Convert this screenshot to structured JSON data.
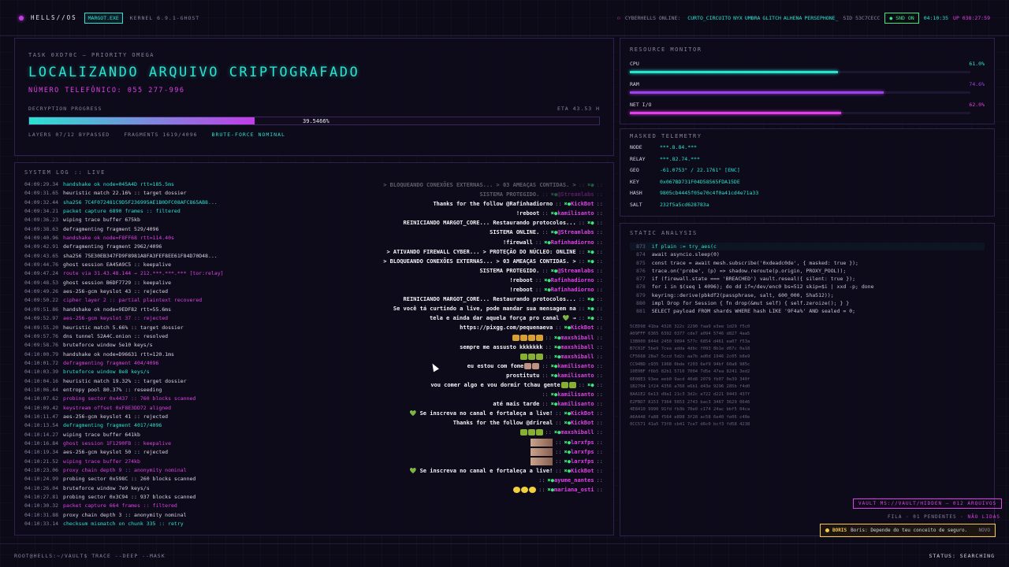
{
  "topbar": {
    "logo": "HELLS//OS",
    "process": "MARGOT.EXE",
    "kernel": "KERNEL 6.9.1-GHOST",
    "online_label": "CYBERHELLS ONLINE:",
    "online_users": [
      "CURTO_CIRCUITO",
      "NYX",
      "UMBRA",
      "GLITCH",
      "ALHENA",
      "PERSEPHONE_"
    ],
    "sid": "SID 53C7CECC",
    "snd": "SND ON",
    "clock": "04:10:35",
    "uptime": "UP 038:27:59"
  },
  "task": {
    "label": "TASK 0XD70C — PRIORITY OMEGA",
    "title": "LOCALIZANDO ARQUIVO CRIPTOGRAFADO",
    "phone": "NÚMERO TELEFÔNICO: 055 277-996",
    "progress_label": "DECRYPTION PROGRESS",
    "eta": "ETA 43.53 H",
    "progress": 0.395466,
    "progress_text": "39.5466%",
    "layers": "LAYERS 07/12 BYPASSED",
    "fragments": "FRAGMENTS 1619/4096",
    "mode": "BRUTE-FORCE NOMINAL"
  },
  "syslog": {
    "title": "SYSTEM LOG :: LIVE",
    "lines": [
      {
        "t": "04:09:29.34",
        "x": "handshake ok node=045A4D rtt=185.5ms",
        "c": "c"
      },
      {
        "t": "04:09:31.65",
        "x": "heuristic match 22.16% :: target dossier",
        "c": "w"
      },
      {
        "t": "04:09:32.44",
        "x": "sha256 7C4F072481C9D5F236995AE1B0DFC08AFC865AB8...",
        "c": "c"
      },
      {
        "t": "04:09:34.21",
        "x": "packet capture 6890 frames :: filtered",
        "c": "c"
      },
      {
        "t": "04:09:36.23",
        "x": "wiping trace buffer 675kb",
        "c": "w"
      },
      {
        "t": "04:09:38.63",
        "x": "defragmenting fragment 529/4096",
        "c": "w"
      },
      {
        "t": "04:09:40.96",
        "x": "handshake ok node=F8FF68 rtt=114.40s",
        "c": "m"
      },
      {
        "t": "04:09:42.91",
        "x": "defragmenting fragment 2962/4096",
        "c": "w"
      },
      {
        "t": "04:09:43.65",
        "x": "sha256 75E30EB347FD9F8981A8FA3FEF8EE61F84D70D48...",
        "c": "w"
      },
      {
        "t": "04:09:44.76",
        "x": "ghost session EA45A9C5 :: keepalive",
        "c": "w"
      },
      {
        "t": "04:09:47.24",
        "x": "route via 31.43.48.144 → 212.***.***.*** [tor:relay]",
        "c": "m"
      },
      {
        "t": "04:09:48.53",
        "x": "ghost session B6DF7729 :: keepalive",
        "c": "w"
      },
      {
        "t": "04:09:49.26",
        "x": "aes-256-gcm keyslot 43 :: rejected",
        "c": "w"
      },
      {
        "t": "04:09:50.22",
        "x": "cipher layer 2 :: partial plaintext recovered",
        "c": "m"
      },
      {
        "t": "04:09:51.86",
        "x": "handshake ok node=9EDF82 rtt=55.6ms",
        "c": "w"
      },
      {
        "t": "04:09:52.97",
        "x": "aes-256-gcm keyslot 37 :: rejected",
        "c": "m"
      },
      {
        "t": "04:09:55.20",
        "x": "heuristic match 5.66% :: target dossier",
        "c": "w"
      },
      {
        "t": "04:09:57.76",
        "x": "dns tunnel 52A4C.onion :: resolved",
        "c": "w"
      },
      {
        "t": "04:09:58.76",
        "x": "bruteforce window 5e10 keys/s",
        "c": "w"
      },
      {
        "t": "04:10:00.79",
        "x": "handshake ok node=D96631 rtt=120.1ms",
        "c": "w"
      },
      {
        "t": "04:10:01.72",
        "x": "defragmenting fragment 404/4096",
        "c": "m"
      },
      {
        "t": "04:10:03.39",
        "x": "bruteforce window 8e8 keys/s",
        "c": "c"
      },
      {
        "t": "04:10:04.16",
        "x": "heuristic match 19.32% :: target dossier",
        "c": "w"
      },
      {
        "t": "04:10:06.44",
        "x": "entropy pool 80.37% :: reseeding",
        "c": "w"
      },
      {
        "t": "04:10:07.62",
        "x": "probing sector 0x4437 :: 760 blocks scanned",
        "c": "m"
      },
      {
        "t": "04:10:09.42",
        "x": "keystream offset 0xF8E3DD72 aligned",
        "c": "m"
      },
      {
        "t": "04:10:11.47",
        "x": "aes-256-gcm keyslot 41 :: rejected",
        "c": "w"
      },
      {
        "t": "04:10:13.54",
        "x": "defragmenting fragment 4017/4096",
        "c": "c"
      },
      {
        "t": "04:10:14.27",
        "x": "wiping trace buffer 641kb",
        "c": "w"
      },
      {
        "t": "04:10:16.84",
        "x": "ghost session 1F1290FB :: keepalive",
        "c": "m"
      },
      {
        "t": "04:10:19.34",
        "x": "aes-256-gcm keyslot 50 :: rejected",
        "c": "w"
      },
      {
        "t": "04:10:21.52",
        "x": "wiping trace buffer 274kb",
        "c": "m"
      },
      {
        "t": "04:10:23.06",
        "x": "proxy chain depth 9 :: anonymity nominal",
        "c": "m"
      },
      {
        "t": "04:10:24.99",
        "x": "probing sector 0x598C :: 260 blocks scanned",
        "c": "w"
      },
      {
        "t": "04:10:26.04",
        "x": "bruteforce window 7e9 keys/s",
        "c": "w"
      },
      {
        "t": "04:10:27.81",
        "x": "probing sector 0x3C94 :: 937 blocks scanned",
        "c": "w"
      },
      {
        "t": "04:10:30.32",
        "x": "packet capture 664 frames :: filtered",
        "c": "m"
      },
      {
        "t": "04:10:31.88",
        "x": "proxy chain depth 3 :: anonymity nominal",
        "c": "w"
      },
      {
        "t": "04:10:33.14",
        "x": "checksum mismatch on chunk 335 :: retry",
        "c": "c"
      }
    ],
    "chat": [
      {
        "msg": "> BLOQUEANDO CONEXÕES EXTERNAS... > 03 AMEAÇAS CONTIDAS. >",
        "user": "",
        "fade": true
      },
      {
        "msg": "SISTEMA PROTEGIDO.",
        "user": "@Streamlabs",
        "fade": true
      },
      {
        "msg": "Thanks for the follow @Rafinhadiorno",
        "user": "KickBot"
      },
      {
        "msg": "!reboot",
        "user": "kamilisanto"
      },
      {
        "msg": "REINICIANDO MARGOT_CORE... Restaurando protocolos...",
        "user": ""
      },
      {
        "msg": "SISTEMA ONLINE.",
        "user": "@Streamlabs"
      },
      {
        "msg": "!firewall",
        "user": "Rafinhadiorno"
      },
      {
        "msg": "> ATIVANDO FIREWALL CYBER... > PROTEÇÃO DO NÚCLEO: ONLINE",
        "user": ""
      },
      {
        "msg": "> BLOQUEANDO CONEXÕES EXTERNAS... > 03 AMEAÇAS CONTIDAS. >",
        "user": ""
      },
      {
        "msg": "SISTEMA PROTEGIDO.",
        "user": "@Streamlabs"
      },
      {
        "msg": "!reboot",
        "user": "Rafinhadiorno"
      },
      {
        "msg": "!reboot",
        "user": "Rafinhadiorno"
      },
      {
        "msg": "REINICIANDO MARGOT_CORE... Restaurando protocolos...",
        "user": ""
      },
      {
        "msg": "Se você tá curtindo a live, pode mandar sua mensagem na",
        "user": ""
      },
      {
        "msg": "tela e ainda dar aquela força pro canal 💚 →",
        "user": ""
      },
      {
        "msg": "https://pixgg.com/pequenaeva",
        "user": "KickBot"
      },
      {
        "msg": "",
        "user": "maxshiball",
        "emotes": "yyyy"
      },
      {
        "msg": "sempre me assusto kkkkkkk",
        "user": "maxshiball"
      },
      {
        "msg": "",
        "user": "maxshiball",
        "emotes": "ggg"
      },
      {
        "msg": "eu estou com fome",
        "user": "kamilisanto",
        "emotes": "ss"
      },
      {
        "msg": "prostitutu",
        "user": "kamilisanto"
      },
      {
        "msg": "vou comer algo e vou dormir tchau gente",
        "user": "",
        "emotes": "gg"
      },
      {
        "msg": "",
        "user": "kamilisanto"
      },
      {
        "msg": "até mais tarde",
        "user": "kamilisanto"
      },
      {
        "msg": "💚 Se inscreva no canal e fortaleça a live!",
        "user": "KickBot"
      },
      {
        "msg": "Thanks for the follow @drireal",
        "user": "KickBot"
      },
      {
        "msg": "",
        "user": "maxshiball",
        "emotes": "ggg"
      },
      {
        "msg": "",
        "user": "larxfps",
        "thumb": true
      },
      {
        "msg": "",
        "user": "larxfps",
        "thumb": true
      },
      {
        "msg": "",
        "user": "larxfps",
        "thumb": true
      },
      {
        "msg": "💚 Se inscreva no canal e fortaleça a live!",
        "user": "KickBot"
      },
      {
        "msg": "",
        "user": "ayume_nantes"
      },
      {
        "msg": "",
        "user": "mariana_osti",
        "emotes": "ooo"
      }
    ]
  },
  "resources": {
    "title": "RESOURCE MONITOR",
    "items": [
      {
        "label": "CPU",
        "value": "61.0%",
        "pct": 0.61,
        "color": "#29e3d0"
      },
      {
        "label": "RAM",
        "value": "74.6%",
        "pct": 0.746,
        "color": "#a040e8"
      },
      {
        "label": "NET I/O",
        "value": "62.0%",
        "pct": 0.62,
        "color": "#e040e8"
      }
    ]
  },
  "telemetry": {
    "title": "MASKED TELEMETRY",
    "rows": [
      {
        "k": "NODE",
        "v": "***.8.84.***"
      },
      {
        "k": "RELAY",
        "v": "***.82.74.***"
      },
      {
        "k": "GEO",
        "v": "-61.0753° / 22.1761° [ENC]"
      },
      {
        "k": "KEY",
        "v": "0x067BD731F04D58565FDA15DE"
      },
      {
        "k": "HASH",
        "v": "9805cb4445f05e70c4f0a41cd4e71a33"
      },
      {
        "k": "SALT",
        "v": "232f5a5cd628783a"
      }
    ]
  },
  "static": {
    "title": "STATIC ANALYSIS",
    "code": [
      {
        "n": "873",
        "t": "if plain := try_aes(c",
        "hl": true
      },
      {
        "n": "874",
        "t": "await asyncio.sleep(0)"
      },
      {
        "n": "875",
        "t": "const trace = await mesh.subscribe('0xdeadc0de', { masked: true });"
      },
      {
        "n": "876",
        "t": "trace.on('probe', (p) => shadow.reroute(p.origin, PROXY_POOL));"
      },
      {
        "n": "877",
        "t": "if (firewall.state === 'BREACHED') vault.reseal({ silent: true });"
      },
      {
        "n": "878",
        "t": "for i in $(seq 1 4096); do dd if=/dev/enc0 bs=512 skip=$i | xxd -p; done"
      },
      {
        "n": "879",
        "t": "keyring::derive(pbkdf2(passphrase, salt, 600_000, Sha512));"
      },
      {
        "n": "880",
        "t": "impl Drop for Session { fn drop(&mut self) { self.zeroize(); } }"
      },
      {
        "n": "881",
        "t": "SELECT payload FROM shards WHERE hash LIKE '9F4a%' AND sealed = 0;"
      }
    ],
    "hex": [
      "5CED98 41ba 4326 322c 2290 faa9 e3ee 1d29 f5c0",
      "A09FFF 6365 6392 0377 cde7 a094 5746 d827 4aa5",
      "13B000 844d 2450 9894 577c 6854 d461 ea07 f53a",
      "B7C01F 5be9 7cea adda 4dbc f093 8b1e d67c 0a18",
      "CF5668 28a7 5ccd 5d2c aa7b ad0d 1946 2c05 b8e9",
      "CC94BD c935 1968 0bde f203 6ef9 94bf 60a8 985c",
      "10E0BF f6b5 82b1 5716 7004 7d5e 47ea 8241 3ed2",
      "6E08E3 93ee eeb0 9acd 40d8 2079 fb07 0e39 340f",
      "1B2704 1f24 4356 a760 e6b1 d43e 9296 285b f4d0",
      "8AA1E2 6e13 d9a1 21c3 3d2c e722 d221 0443 437f",
      "E2FBD7 8153 7364 5653 2743 bac3 3467 3629 0646",
      "4E8410 9990 91fd fb3b 70e0 c174 24ac bbf5 04ca",
      "A6A448 fa88 f564 e898 3f28 ac58 6e40 fe06 c40e",
      "0CC571 41a5 73f8 cb41 7ce7 d6c0 bcf3 fd58 4238"
    ]
  },
  "vault": "VAULT MS://VAULT/HIDDEN — 012 ARQUIVOS",
  "fila": {
    "label": "FILA · 01 PENDENTES ·",
    "status": "NÃO LIDAS"
  },
  "toast": {
    "name": "BORIS",
    "text": "Boris: Depende do teu conceito de seguro.",
    "tag": "NOVO"
  },
  "bottombar": {
    "prompt": "ROOT@HELLS:~/VAULT$ TRACE --DEEP --MASK",
    "status": "STATUS: SEARCHING"
  }
}
